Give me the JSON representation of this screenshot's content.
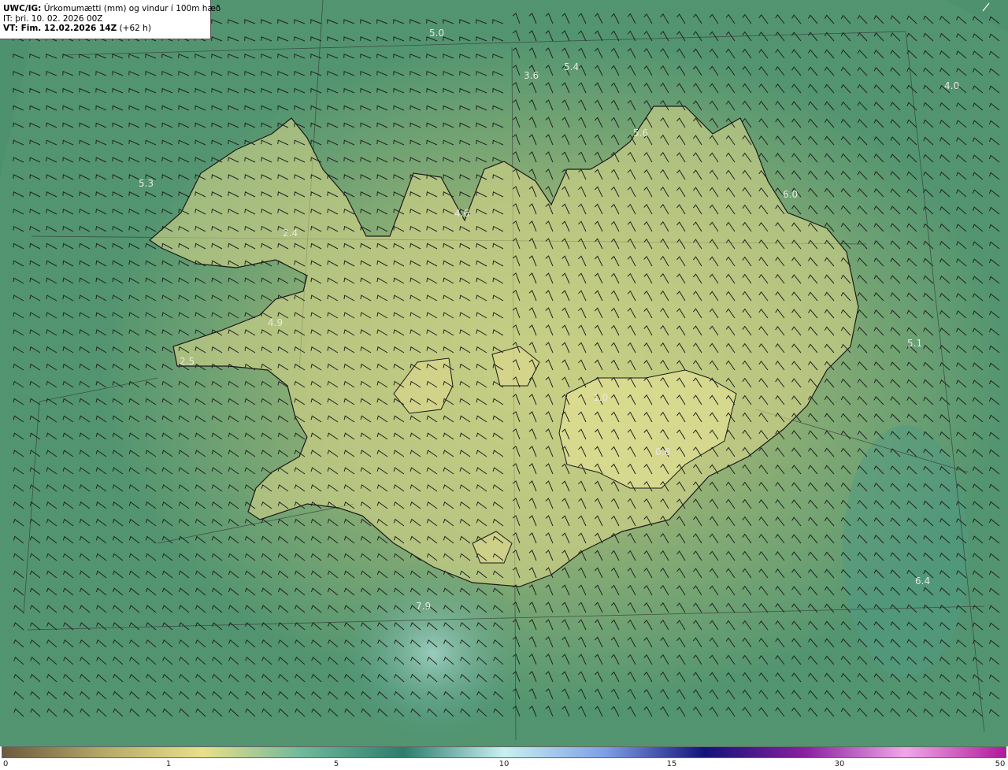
{
  "header": {
    "model": "UWC/IG:",
    "field": "Úrkomumætti (mm) og vindur í 100m hæð",
    "it": "IT: þri. 10. 02. 2026 00Z",
    "vt_label": "VT: Fim. 12.02.2026 14Z",
    "vt_offset": "(+62 h)"
  },
  "map": {
    "labels": [
      "5.0",
      "3.6",
      "5.4",
      "4.0",
      "5.6",
      "5.3",
      "4.6",
      "6.0",
      "2.4",
      "4.9",
      "5.1",
      "2.5",
      "1.0",
      "0.6",
      "6.4",
      "7.9"
    ],
    "colors": {
      "sea_dark": "#2f7a63",
      "land_light": "#e7e08e",
      "coast": "#1a1a1a"
    }
  },
  "colorbar": {
    "ticks": [
      "0",
      "1",
      "5",
      "10",
      "15",
      "30",
      "50"
    ],
    "colors": [
      "#6b5a3f",
      "#b5a867",
      "#e8e08a",
      "#6fb79b",
      "#2d7c6c",
      "#c8f0f0",
      "#7fa0e6",
      "#12127a",
      "#8a1fa0",
      "#f0a7e8",
      "#b01a9a"
    ]
  }
}
